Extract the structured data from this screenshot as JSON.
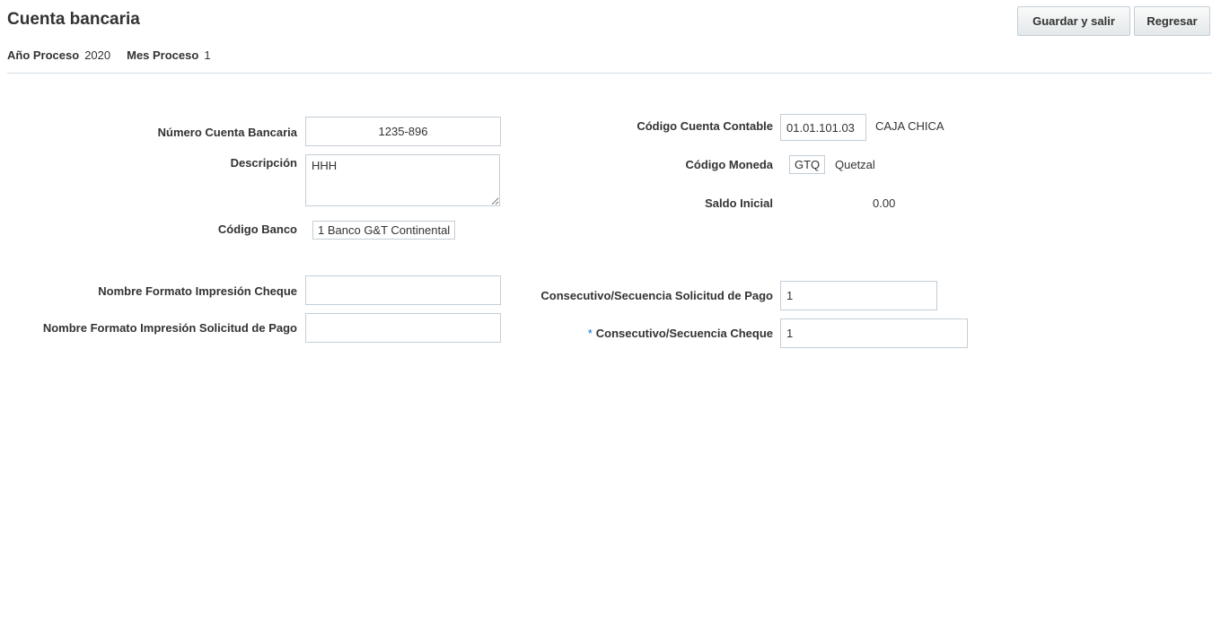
{
  "header": {
    "title": "Cuenta bancaria",
    "year_label": "Año Proceso",
    "year_value": "2020",
    "month_label": "Mes Proceso",
    "month_value": "1"
  },
  "toolbar": {
    "save_exit_label": "Guardar y salir",
    "back_label": "Regresar"
  },
  "form": {
    "account_number": {
      "label": "Número Cuenta Bancaria",
      "value": "1235-896"
    },
    "description": {
      "label": "Descripción",
      "value": "HHH"
    },
    "bank_code": {
      "label": "Código Banco",
      "value": "1 Banco G&T Continental"
    },
    "check_print_format": {
      "label": "Nombre Formato Impresión Cheque",
      "value": ""
    },
    "payment_request_print_format": {
      "label": "Nombre Formato Impresión Solicitud de Pago",
      "value": ""
    },
    "ledger_account_code": {
      "label": "Código Cuenta Contable",
      "value": "01.01.101.03",
      "description": "CAJA CHICA"
    },
    "currency_code": {
      "label": "Código Moneda",
      "code": "GTQ",
      "name": "Quetzal"
    },
    "opening_balance": {
      "label": "Saldo Inicial",
      "value": "0.00"
    },
    "payment_request_sequence": {
      "label": "Consecutivo/Secuencia Solicitud de Pago",
      "value": "1"
    },
    "check_sequence": {
      "label": "Consecutivo/Secuencia Cheque",
      "value": "1",
      "required_marker": "*"
    }
  },
  "colors": {
    "required_marker": "#0572ce",
    "border": "#c4ced7",
    "divider": "#d6dfe6"
  }
}
